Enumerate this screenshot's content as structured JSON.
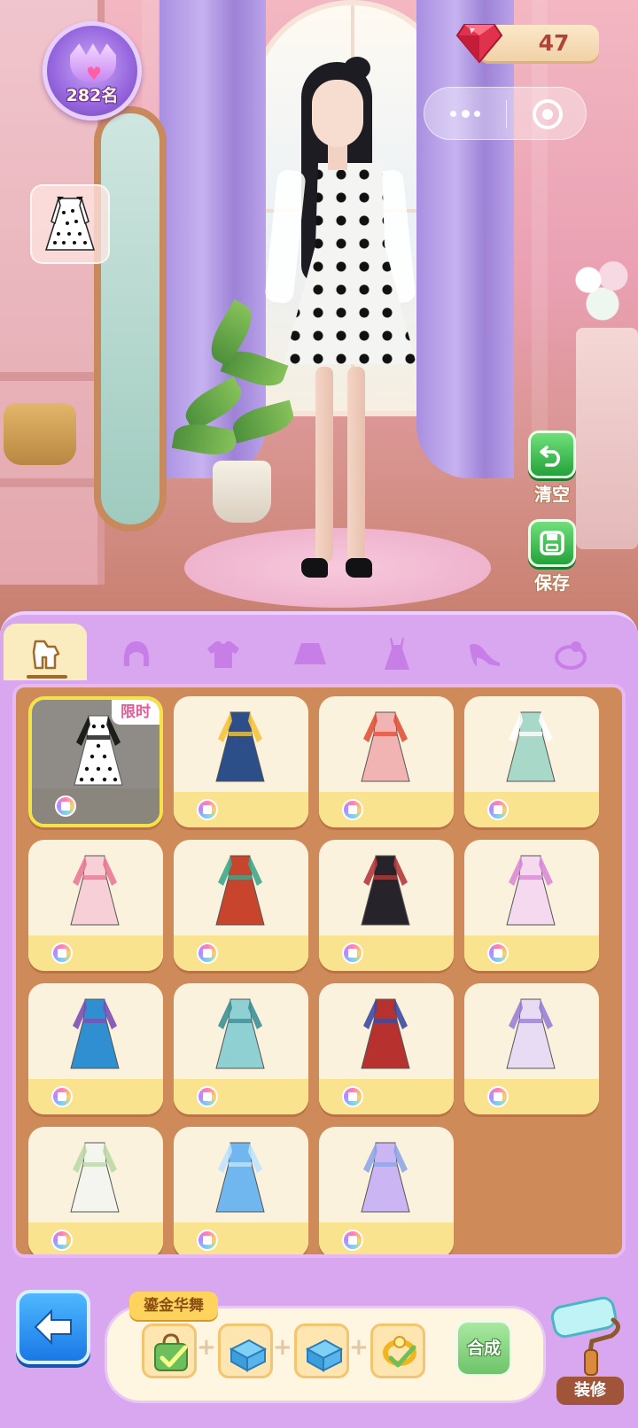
{
  "hud": {
    "rank_text": "282名",
    "gem_count": "47"
  },
  "side_buttons": {
    "clear_label": "清空",
    "save_label": "保存"
  },
  "tabs": [
    {
      "name": "tab-full-outfit",
      "icon": "outfit-icon",
      "active": true
    },
    {
      "name": "tab-hair",
      "icon": "hair-icon",
      "active": false
    },
    {
      "name": "tab-tops",
      "icon": "shirt-icon",
      "active": false
    },
    {
      "name": "tab-skirts",
      "icon": "skirt-icon",
      "active": false
    },
    {
      "name": "tab-dresses",
      "icon": "dress-icon",
      "active": false
    },
    {
      "name": "tab-shoes",
      "icon": "high-heel-icon",
      "active": false
    },
    {
      "name": "tab-accessories",
      "icon": "accessory-icon",
      "active": false
    }
  ],
  "items": [
    {
      "name": "polka-dot-dress",
      "tag": "限时",
      "selected": true,
      "color": "#ffffff",
      "accent": "#111111"
    },
    {
      "name": "denim-overalls",
      "tag": "",
      "selected": false,
      "color": "#2c4f8a",
      "accent": "#f6c33c"
    },
    {
      "name": "red-pink-coat-dress",
      "tag": "",
      "selected": false,
      "color": "#f2b3b3",
      "accent": "#e0533a"
    },
    {
      "name": "mint-qipao-skirt",
      "tag": "",
      "selected": false,
      "color": "#a8d8c8",
      "accent": "#ffffff"
    },
    {
      "name": "pink-blossom-gown",
      "tag": "",
      "selected": false,
      "color": "#f7cfd6",
      "accent": "#e97a95"
    },
    {
      "name": "red-gold-hanfu",
      "tag": "",
      "selected": false,
      "color": "#c8442d",
      "accent": "#3fa88a"
    },
    {
      "name": "black-red-robe",
      "tag": "",
      "selected": false,
      "color": "#26232b",
      "accent": "#b33b3b"
    },
    {
      "name": "pink-lolita-set",
      "tag": "",
      "selected": false,
      "color": "#f4d9ef",
      "accent": "#d98ad7"
    },
    {
      "name": "blue-ethnic-dress",
      "tag": "",
      "selected": false,
      "color": "#2f8fd0",
      "accent": "#7a4fb4"
    },
    {
      "name": "teal-floral-hanfu",
      "tag": "",
      "selected": false,
      "color": "#8fd0d2",
      "accent": "#3d8f95"
    },
    {
      "name": "red-embroidered-set",
      "tag": "",
      "selected": false,
      "color": "#b7322e",
      "accent": "#3c4aa0"
    },
    {
      "name": "lavender-qipao",
      "tag": "",
      "selected": false,
      "color": "#e8dcf5",
      "accent": "#9b7fd6"
    },
    {
      "name": "white-puff-dress",
      "tag": "",
      "selected": false,
      "color": "#f5f5ef",
      "accent": "#bcd9a7"
    },
    {
      "name": "blue-princess-gown",
      "tag": "",
      "selected": false,
      "color": "#6fb7ee",
      "accent": "#bfe3ff"
    },
    {
      "name": "lilac-fairy-gown",
      "tag": "",
      "selected": false,
      "color": "#cbb5f2",
      "accent": "#8fa6e8"
    }
  ],
  "synthesis": {
    "set_name": "鎏金华舞",
    "button_label": "合成",
    "requirements": [
      {
        "name": "green-bag",
        "owned": true
      },
      {
        "name": "blue-shoe-box",
        "owned": false
      },
      {
        "name": "blue-shoe-box",
        "owned": false
      },
      {
        "name": "gold-ring",
        "owned": true
      }
    ]
  },
  "decorate": {
    "label": "装修"
  },
  "colors": {
    "panel": "#d9a7f0",
    "grid": "#cf8a5a",
    "card": "#fbf2dd",
    "card_bottom": "#f9e38f",
    "selected_border": "#f4e24a",
    "accent_green": "#25a23b",
    "back_blue": "#1a78e6"
  }
}
